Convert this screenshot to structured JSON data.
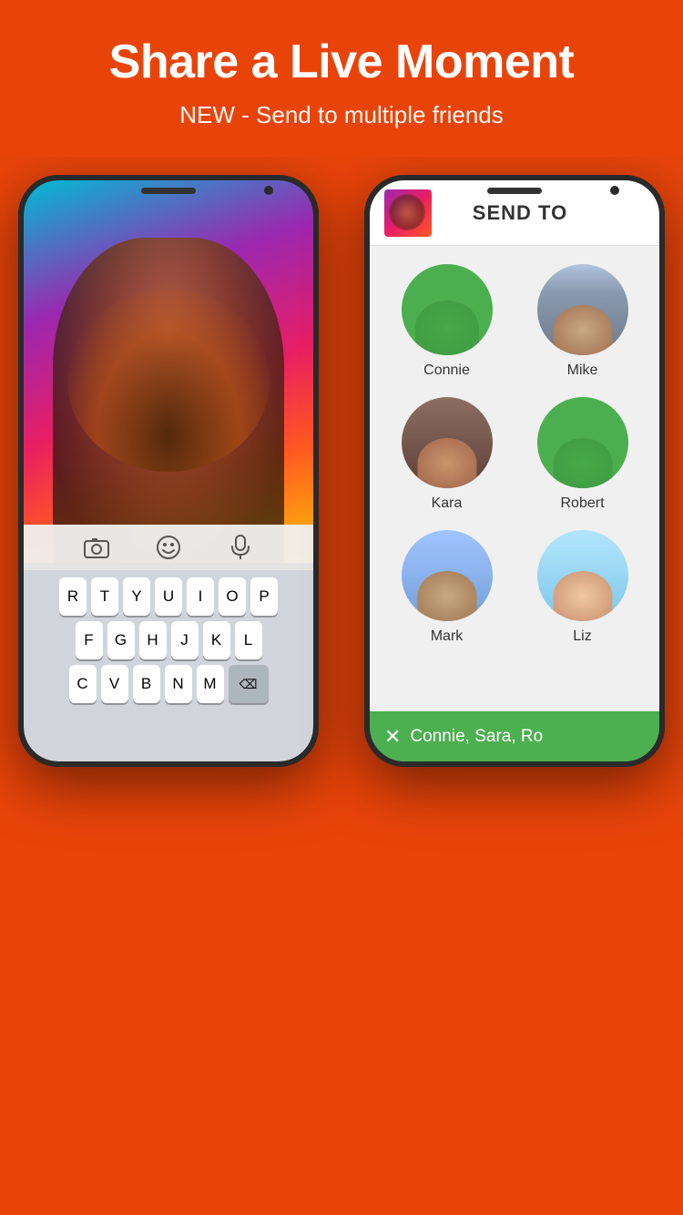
{
  "header": {
    "title": "Share a Live Moment",
    "subtitle": "NEW - Send to multiple friends"
  },
  "left_phone": {
    "keyboard": {
      "rows": [
        [
          "R",
          "T",
          "Y",
          "U",
          "I",
          "O",
          "P"
        ],
        [
          "F",
          "G",
          "H",
          "J",
          "K",
          "L"
        ],
        [
          "C",
          "V",
          "B",
          "N",
          "M"
        ]
      ]
    },
    "bottom_icons": [
      "📷",
      "😊",
      "🎤"
    ]
  },
  "right_phone": {
    "send_to_label": "SEND TO",
    "contacts": [
      {
        "name": "Connie",
        "selected": true,
        "avatar_class": "av-connie"
      },
      {
        "name": "Mike",
        "selected": false,
        "avatar_class": "av-mike"
      },
      {
        "name": "Kara",
        "selected": false,
        "avatar_class": "av-kara"
      },
      {
        "name": "Robert",
        "selected": true,
        "avatar_class": "av-robert"
      },
      {
        "name": "Mark",
        "selected": false,
        "avatar_class": "av-mark"
      },
      {
        "name": "Liz",
        "selected": false,
        "avatar_class": "av-liz"
      }
    ],
    "send_bar": {
      "close": "✕",
      "names": "Connie, Sara, Ro"
    }
  },
  "colors": {
    "accent_orange": "#e8440a",
    "accent_green": "#4caf50",
    "white": "#ffffff"
  }
}
